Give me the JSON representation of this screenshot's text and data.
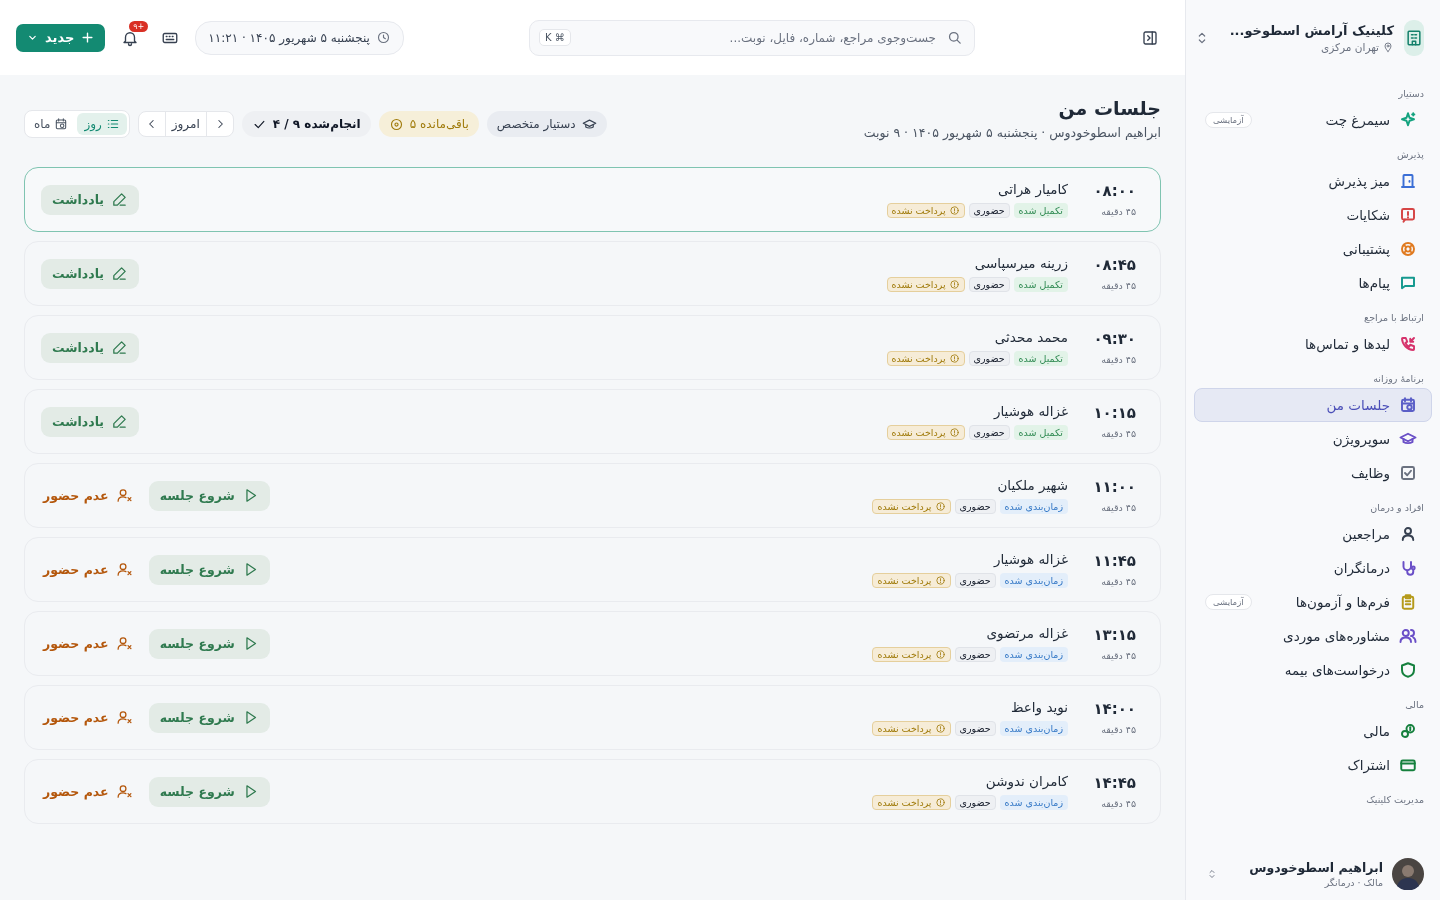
{
  "sidebar": {
    "clinic": {
      "name": "کلینیک آرامش اسطوخو...",
      "location": "تهران مرکزی"
    },
    "sections": [
      {
        "title": "دستیار",
        "items": [
          {
            "label": "سیمرغ چت",
            "color": "#14a37f",
            "badge": "آزمایشی",
            "selected": false
          }
        ]
      },
      {
        "title": "پذیرش",
        "items": [
          {
            "label": "میز پذیرش",
            "color": "#3b6fd6",
            "selected": false
          },
          {
            "label": "شکایات",
            "color": "#d64545",
            "selected": false
          },
          {
            "label": "پشتیبانی",
            "color": "#e07a1f",
            "selected": false
          },
          {
            "label": "پیام‌ها",
            "color": "#14998f",
            "selected": false
          }
        ]
      },
      {
        "title": "ارتباط با مراجع",
        "items": [
          {
            "label": "لیدها و تماس‌ها",
            "color": "#d6336c",
            "selected": false
          }
        ]
      },
      {
        "title": "برنامهٔ روزانه",
        "items": [
          {
            "label": "جلسات من",
            "color": "#5b5fc7",
            "selected": true
          },
          {
            "label": "سوپرویژن",
            "color": "#6a4fc7",
            "selected": false
          },
          {
            "label": "وظایف",
            "color": "#6b7280",
            "selected": false
          }
        ]
      },
      {
        "title": "افراد و درمان",
        "items": [
          {
            "label": "مراجعین",
            "color": "#374151",
            "selected": false
          },
          {
            "label": "درمانگران",
            "color": "#6a4fc7",
            "selected": false
          },
          {
            "label": "فرم‌ها و آزمون‌ها",
            "color": "#b59a1a",
            "badge": "آزمایشی",
            "selected": false
          },
          {
            "label": "مشاوره‌های موردی",
            "color": "#6a4fc7",
            "selected": false
          },
          {
            "label": "درخواست‌های بیمه",
            "color": "#15803d",
            "selected": false
          }
        ]
      },
      {
        "title": "مالی",
        "items": [
          {
            "label": "مالی",
            "color": "#15803d",
            "selected": false
          },
          {
            "label": "اشتراک",
            "color": "#15803d",
            "selected": false
          }
        ]
      },
      {
        "title": "مدیریت کلینیک"
      }
    ],
    "user": {
      "name": "ابراهیم اسطوخودوس",
      "role": "مالک · درمانگر"
    }
  },
  "topbar": {
    "search": {
      "placeholder": "جست‌وجوی مراجع، شماره، فایل، نوبت...",
      "shortcut": "K ⌘"
    },
    "datetime": "پنجشنبه ۵ شهریور ۱۴۰۵ · ۱۱:۲۱",
    "notifications": "۹+",
    "new_button": "جدید"
  },
  "header": {
    "title": "جلسات من",
    "subtitle": "ابراهیم اسطوخودوس · پنجشنبه ۵ شهریور ۱۴۰۵ · ۹ نوبت"
  },
  "toolbar": {
    "assistant": "دستیار متخصص",
    "remaining": "۵ باقی‌مانده",
    "done": "۴ / ۹ انجام‌شده",
    "today": "امروز",
    "views": [
      {
        "label": "روز",
        "selected": true
      },
      {
        "label": "ماه",
        "selected": false
      }
    ]
  },
  "sessions": [
    {
      "time": "۰۸:۰۰",
      "duration": "۴۵ دقیقه",
      "name": "کامیار هراتی",
      "status": {
        "label": "تکمیل شده",
        "kind": "completed"
      },
      "mode": "حضوری",
      "payment": "پرداخت نشده",
      "selected": true,
      "actions": [
        {
          "label": "یادداشت",
          "kind": "note"
        }
      ]
    },
    {
      "time": "۰۸:۴۵",
      "duration": "۴۵ دقیقه",
      "name": "زرینه میرسپاسی",
      "status": {
        "label": "تکمیل شده",
        "kind": "completed"
      },
      "mode": "حضوری",
      "payment": "پرداخت نشده",
      "selected": false,
      "actions": [
        {
          "label": "یادداشت",
          "kind": "note"
        }
      ]
    },
    {
      "time": "۰۹:۳۰",
      "duration": "۴۵ دقیقه",
      "name": "محمد محدثی",
      "status": {
        "label": "تکمیل شده",
        "kind": "completed"
      },
      "mode": "حضوری",
      "payment": "پرداخت نشده",
      "selected": false,
      "actions": [
        {
          "label": "یادداشت",
          "kind": "note"
        }
      ]
    },
    {
      "time": "۱۰:۱۵",
      "duration": "۴۵ دقیقه",
      "name": "غزاله هوشیار",
      "status": {
        "label": "تکمیل شده",
        "kind": "completed"
      },
      "mode": "حضوری",
      "payment": "پرداخت نشده",
      "selected": false,
      "actions": [
        {
          "label": "یادداشت",
          "kind": "note"
        }
      ]
    },
    {
      "time": "۱۱:۰۰",
      "duration": "۴۵ دقیقه",
      "name": "شهیر ملکیان",
      "status": {
        "label": "زمان‌بندی شده",
        "kind": "scheduled"
      },
      "mode": "حضوری",
      "payment": "پرداخت نشده",
      "selected": false,
      "actions": [
        {
          "label": "شروع جلسه",
          "kind": "start"
        },
        {
          "label": "عدم حضور",
          "kind": "noshow"
        }
      ]
    },
    {
      "time": "۱۱:۴۵",
      "duration": "۴۵ دقیقه",
      "name": "غزاله هوشیار",
      "status": {
        "label": "زمان‌بندی شده",
        "kind": "scheduled"
      },
      "mode": "حضوری",
      "payment": "پرداخت نشده",
      "selected": false,
      "actions": [
        {
          "label": "شروع جلسه",
          "kind": "start"
        },
        {
          "label": "عدم حضور",
          "kind": "noshow"
        }
      ]
    },
    {
      "time": "۱۳:۱۵",
      "duration": "۴۵ دقیقه",
      "name": "غزاله مرتضوی",
      "status": {
        "label": "زمان‌بندی شده",
        "kind": "scheduled"
      },
      "mode": "حضوری",
      "payment": "پرداخت نشده",
      "selected": false,
      "actions": [
        {
          "label": "شروع جلسه",
          "kind": "start"
        },
        {
          "label": "عدم حضور",
          "kind": "noshow"
        }
      ]
    },
    {
      "time": "۱۴:۰۰",
      "duration": "۴۵ دقیقه",
      "name": "نوید واعظ",
      "status": {
        "label": "زمان‌بندی شده",
        "kind": "scheduled"
      },
      "mode": "حضوری",
      "payment": "پرداخت نشده",
      "selected": false,
      "actions": [
        {
          "label": "شروع جلسه",
          "kind": "start"
        },
        {
          "label": "عدم حضور",
          "kind": "noshow"
        }
      ]
    },
    {
      "time": "۱۴:۴۵",
      "duration": "۴۵ دقیقه",
      "name": "کامران ندوشن",
      "status": {
        "label": "زمان‌بندی شده",
        "kind": "scheduled"
      },
      "mode": "حضوری",
      "payment": "پرداخت نشده",
      "selected": false,
      "actions": [
        {
          "label": "شروع جلسه",
          "kind": "start"
        },
        {
          "label": "عدم حضور",
          "kind": "noshow"
        }
      ]
    }
  ]
}
